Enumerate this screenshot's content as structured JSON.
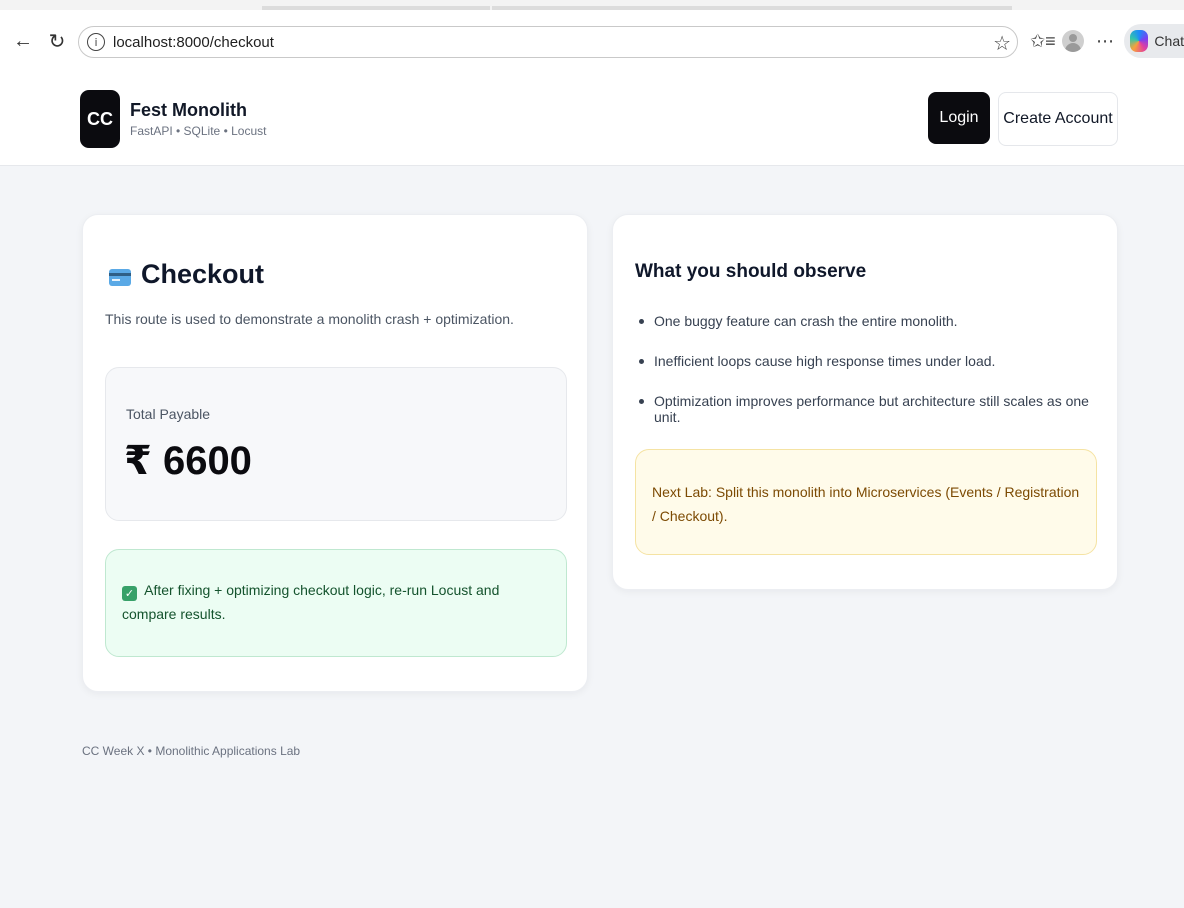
{
  "browser": {
    "url": "localhost:8000/checkout",
    "chat_label": "Chat"
  },
  "header": {
    "logo_text": "CC",
    "brand_title": "Fest Monolith",
    "brand_subtitle": "FastAPI • SQLite • Locust",
    "login_label": "Login",
    "create_account_label": "Create Account"
  },
  "checkout_card": {
    "title": "Checkout",
    "description": "This route is used to demonstrate a monolith crash + optimization.",
    "total_label": "Total Payable",
    "total_amount": "₹ 6600",
    "success_message": "After fixing + optimizing checkout logic, re-run Locust and compare results."
  },
  "observe_card": {
    "title": "What you should observe",
    "items": [
      "One buggy feature can crash the entire monolith.",
      "Inefficient loops cause high response times under load.",
      "Optimization improves performance but architecture still scales as one unit."
    ],
    "next_lab": "Next Lab: Split this monolith into Microservices (Events / Registration / Checkout)."
  },
  "footer": {
    "text": "CC Week X • Monolithic Applications Lab"
  }
}
